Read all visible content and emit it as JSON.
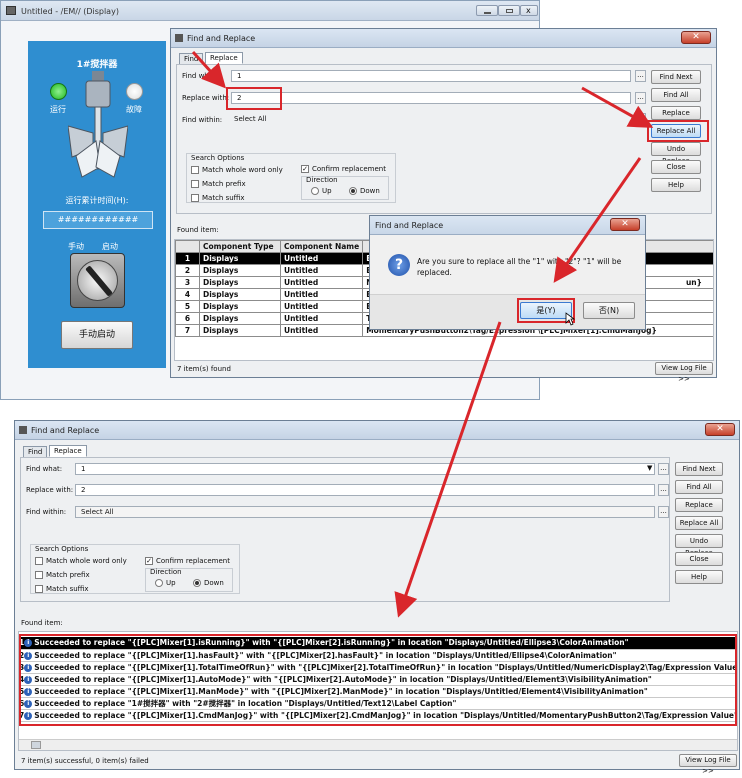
{
  "display_window": {
    "title": "Untitled - /EM// (Display)",
    "panel_title": "1#搅拌器",
    "running_label": "运行",
    "fault_label": "故障",
    "runtime_label": "运行累计时间(H):",
    "counter_value": "############",
    "manual_label": "手动",
    "auto_label": "启动",
    "manual_start_button": "手动启动"
  },
  "top_dialog": {
    "title": "Find and Replace",
    "close_glyph": "✕",
    "tabs": [
      "Find",
      "Replace"
    ],
    "find_what_label": "Find what:",
    "find_what_value": "1",
    "replace_with_label": "Replace with:",
    "replace_with_value": "2",
    "find_within_label": "Find within:",
    "find_within_value": "Select All",
    "dots": "...",
    "buttons": [
      "Find Next",
      "Find All",
      "Replace",
      "Replace All",
      "Undo Replace",
      "Close",
      "Help"
    ],
    "search_options_label": "Search Options",
    "match_whole_word": "Match whole word only",
    "match_prefix": "Match prefix",
    "match_suffix": "Match suffix",
    "confirm_replacement": "Confirm replacement",
    "direction_label": "Direction",
    "up_label": "Up",
    "down_label": "Down",
    "found_label": "Found item:",
    "columns": [
      "Component Type",
      "Component  Name"
    ],
    "rows": [
      {
        "n": "1",
        "type": "Displays",
        "name": "Untitled",
        "loc": "E"
      },
      {
        "n": "2",
        "type": "Displays",
        "name": "Untitled",
        "loc": "E"
      },
      {
        "n": "3",
        "type": "Displays",
        "name": "Untitled",
        "loc": "N"
      },
      {
        "n": "4",
        "type": "Displays",
        "name": "Untitled",
        "loc": "E"
      },
      {
        "n": "5",
        "type": "Displays",
        "name": "Untitled",
        "loc": "E"
      },
      {
        "n": "6",
        "type": "Displays",
        "name": "Untitled",
        "loc": "T"
      },
      {
        "n": "7",
        "type": "Displays",
        "name": "Untitled",
        "loc": "MomentaryPushButton2\\Tag/Expression \\[PLC]Mixer[1].CmdManJog}"
      }
    ],
    "row3_tail": "un}",
    "status": "7 item(s) found",
    "view_log": "View Log File >>"
  },
  "confirm_dialog": {
    "title": "Find and Replace",
    "close_glyph": "✕",
    "message": "Are you sure to replace all the \"1\" with \"2\"? \"1\" will be replaced.",
    "yes": "是(Y)",
    "no": "否(N)"
  },
  "bottom_dialog": {
    "title": "Find and Replace",
    "close_glyph": "✕",
    "tabs": [
      "Find",
      "Replace"
    ],
    "find_what_label": "Find what:",
    "find_what_value": "1",
    "replace_with_label": "Replace with:",
    "replace_with_value": "2",
    "find_within_label": "Find within:",
    "find_within_value": "Select All",
    "dots": "...",
    "buttons": [
      "Find Next",
      "Find All",
      "Replace",
      "Replace All",
      "Undo Replace",
      "Close",
      "Help"
    ],
    "search_options_label": "Search Options",
    "match_whole_word": "Match whole word only",
    "match_prefix": "Match prefix",
    "match_suffix": "Match suffix",
    "confirm_replacement": "Confirm replacement",
    "direction_label": "Direction",
    "up_label": "Up",
    "down_label": "Down",
    "found_label": "Found item:",
    "rows": [
      {
        "n": "1",
        "text": "Succeeded to replace \"{[PLC]Mixer[1].isRunning}\" with \"{[PLC]Mixer[2].isRunning}\" in location \"Displays/Untitled/Ellipse3\\ColorAnimation\""
      },
      {
        "n": "2",
        "text": "Succeeded to replace \"{[PLC]Mixer[1].hasFault}\" with \"{[PLC]Mixer[2].hasFault}\" in location \"Displays/Untitled/Ellipse4\\ColorAnimation\""
      },
      {
        "n": "3",
        "text": "Succeeded to replace \"{[PLC]Mixer[1].TotalTimeOfRun}\" with \"{[PLC]Mixer[2].TotalTimeOfRun}\" in location \"Displays/Untitled/NumericDisplay2\\Tag/Expression Value\""
      },
      {
        "n": "4",
        "text": "Succeeded to replace \"{[PLC]Mixer[1].AutoMode}\" with \"{[PLC]Mixer[2].AutoMode}\" in location \"Displays/Untitled/Element3\\VisibilityAnimation\""
      },
      {
        "n": "5",
        "text": "Succeeded to replace \"{[PLC]Mixer[1].ManMode}\" with \"{[PLC]Mixer[2].ManMode}\" in location \"Displays/Untitled/Element4\\VisibilityAnimation\""
      },
      {
        "n": "6",
        "text": "Succeeded to replace \"1#搅拌器\" with \"2#搅拌器\" in location \"Displays/Untitled/Text12\\Label Caption\""
      },
      {
        "n": "7",
        "text": "Succeeded to replace \"{[PLC]Mixer[1].CmdManJog}\" with \"{[PLC]Mixer[2].CmdManJog}\" in location \"Displays/Untitled/MomentaryPushButton2\\Tag/Expression Value\""
      }
    ],
    "status": "7 item(s) successful, 0 item(s) failed",
    "view_log": "View Log File >>"
  },
  "colors": {
    "accent": "#d9262b",
    "panel": "#2f8ed0",
    "selection": "#000000"
  }
}
